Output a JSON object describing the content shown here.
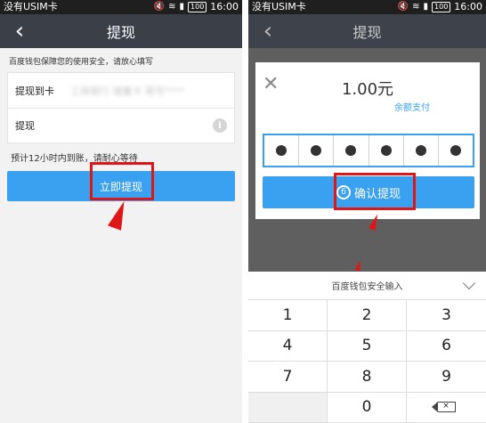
{
  "left": {
    "status": {
      "carrier": "没有USIM卡",
      "battery": "100",
      "time": "16:00"
    },
    "title": "提现",
    "notice": "百度钱包保障您的使用安全，请放心填写",
    "card_row": {
      "label": "提现到卡",
      "value": "工商银行 储蓄卡 尾号****"
    },
    "amount_row": {
      "label": "提现"
    },
    "hint": "预计12小时内到账，请耐心等待",
    "submit_label": "立即提现"
  },
  "right": {
    "status": {
      "carrier": "没有USIM卡",
      "battery": "100",
      "time": "16:00"
    },
    "title": "提现",
    "dialog": {
      "amount": "1.00元",
      "pay_method": "余额支付",
      "pin_digits": 6,
      "confirm_label": "确认提现"
    },
    "keyboard": {
      "title": "百度钱包安全输入",
      "keys": [
        "1",
        "2",
        "3",
        "4",
        "5",
        "6",
        "7",
        "8",
        "9",
        "",
        "0",
        "⌫"
      ]
    }
  },
  "colors": {
    "accent": "#3aa0f0",
    "highlight": "#e01515",
    "titlebar": "#3b3f48"
  }
}
